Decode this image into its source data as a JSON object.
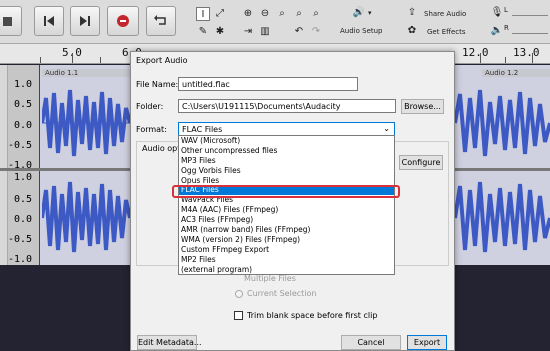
{
  "toolbar": {
    "audio_setup": "Audio Setup",
    "share_audio": "Share Audio",
    "get_effects": "Get Effects",
    "meter_l": "L",
    "meter_r": "R"
  },
  "ruler": {
    "labels": [
      "5.0",
      "6.0",
      "12.0",
      "13.0"
    ]
  },
  "tracks": {
    "clip_left": "Audio 1.1",
    "clip_right": "Audio 1.2",
    "scale": [
      "1.0",
      "0.5",
      "0.0",
      "-0.5",
      "-1.0",
      "1.0",
      "0.5",
      "0.0",
      "-0.5",
      "-1.0"
    ]
  },
  "dialog": {
    "title": "Export Audio",
    "file_name_label": "File Name:",
    "file_name_value": "untitled.flac",
    "folder_label": "Folder:",
    "folder_value": "C:\\Users\\U191115\\Documents\\Audacity",
    "browse_label": "Browse...",
    "format_label": "Format:",
    "format_value": "FLAC Files",
    "audio_options_label": "Audio opti",
    "configure_label": "Configure",
    "format_options": [
      "WAV (Microsoft)",
      "Other uncompressed files",
      "MP3 Files",
      "Ogg Vorbis Files",
      "Opus Files",
      "FLAC Files",
      "WavPack Files",
      "M4A (AAC) Files (FFmpeg)",
      "AC3 Files (FFmpeg)",
      "AMR (narrow band) Files (FFmpeg)",
      "WMA (version 2) Files (FFmpeg)",
      "Custom FFmpeg Export",
      "MP2 Files",
      "(external program)"
    ],
    "multiple_files_label": "Multiple Files",
    "current_selection_label": "Current Selection",
    "trim_label": "Trim blank space before first clip",
    "edit_metadata_label": "Edit Metadata...",
    "cancel_label": "Cancel",
    "export_label": "Export"
  }
}
